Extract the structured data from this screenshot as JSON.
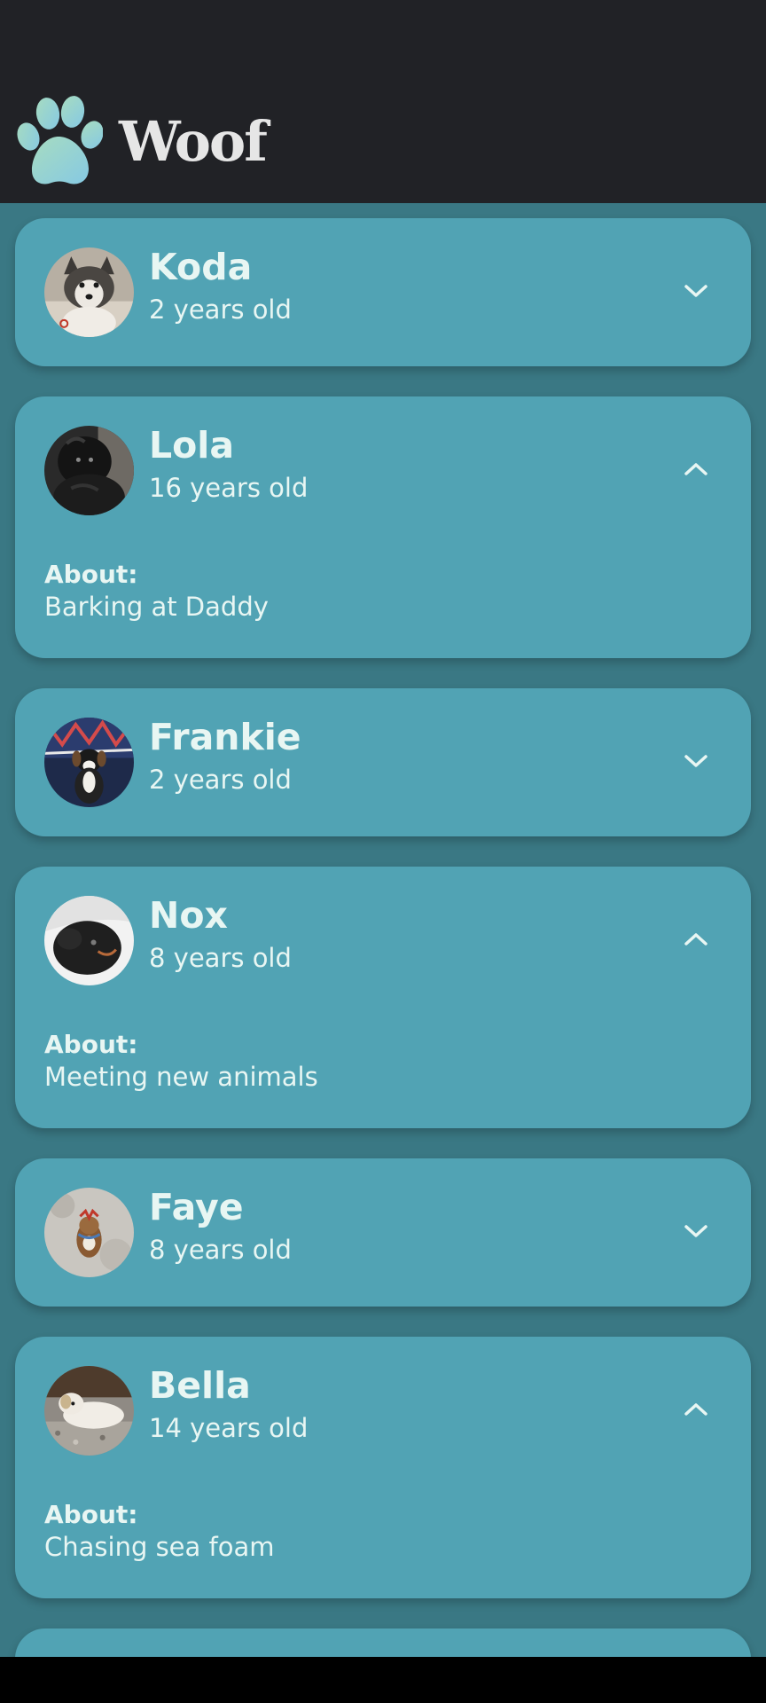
{
  "app": {
    "title": "Woof",
    "logo_icon": "paw-icon"
  },
  "colors": {
    "top_bar": "#212226",
    "page_background": "#3a7884",
    "card_background": "#51a3b4",
    "text": "#e8f6f3",
    "logo_gradient_start": "#a7dcc0",
    "logo_gradient_end": "#86c9e3"
  },
  "dogs": [
    {
      "name": "Koda",
      "age": "2 years old",
      "expanded": false,
      "toggle_icon": "chevron-down-icon"
    },
    {
      "name": "Lola",
      "age": "16 years old",
      "expanded": true,
      "toggle_icon": "chevron-up-icon",
      "about_label": "About:",
      "about": "Barking at Daddy"
    },
    {
      "name": "Frankie",
      "age": "2 years old",
      "expanded": false,
      "toggle_icon": "chevron-down-icon"
    },
    {
      "name": "Nox",
      "age": "8 years old",
      "expanded": true,
      "toggle_icon": "chevron-up-icon",
      "about_label": "About:",
      "about": "Meeting new animals"
    },
    {
      "name": "Faye",
      "age": "8 years old",
      "expanded": false,
      "toggle_icon": "chevron-down-icon"
    },
    {
      "name": "Bella",
      "age": "14 years old",
      "expanded": true,
      "toggle_icon": "chevron-up-icon",
      "about_label": "About:",
      "about": "Chasing sea foam"
    }
  ]
}
